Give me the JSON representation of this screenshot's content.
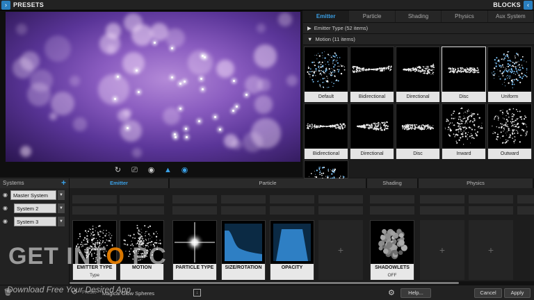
{
  "topbar": {
    "left_title": "PRESETS",
    "right_title": "BLOCKS",
    "left_arrow": "›",
    "right_arrow": "‹"
  },
  "preview_toolbar": [
    {
      "name": "reset-icon",
      "glyph": "↻"
    },
    {
      "name": "camera-icon",
      "glyph": "⎚"
    },
    {
      "name": "audio-icon",
      "glyph": "◉"
    },
    {
      "name": "emitter-icon",
      "glyph": "▲"
    },
    {
      "name": "eye-icon",
      "glyph": "◉"
    }
  ],
  "blocks": {
    "tabs": [
      "Emitter",
      "Particle",
      "Shading",
      "Physics",
      "Aux System"
    ],
    "active_tab": "Emitter",
    "categories": [
      {
        "label": "Emitter Type",
        "count": "(52 items)",
        "expanded": false
      },
      {
        "label": "Motion",
        "count": "(11 items)",
        "expanded": true
      }
    ],
    "items": [
      "Default",
      "Bidirectional",
      "Directional",
      "Disc",
      "Uniform",
      "Bidirectional",
      "Directional",
      "Disc",
      "Inward",
      "Outward",
      ""
    ],
    "selected_index": 3
  },
  "systems": {
    "title": "Systems",
    "add": "+",
    "items": [
      "Master System",
      "System 2",
      "System 3"
    ]
  },
  "modules": {
    "sections": [
      "Emitter",
      "Particle",
      "Shading",
      "Physics"
    ],
    "active_section": "Emitter",
    "emitter": [
      {
        "l1": "EMITTER TYPE",
        "l2": "Type"
      },
      {
        "l1": "MOTION",
        "l2": ""
      }
    ],
    "particle": [
      {
        "l1": "PARTICLE TYPE",
        "l2": ""
      },
      {
        "l1": "SIZE/ROTATION",
        "l2": ""
      },
      {
        "l1": "OPACITY",
        "l2": ""
      }
    ],
    "shading": [
      {
        "l1": "SHADOWLETS",
        "l2": "OFF"
      }
    ]
  },
  "bottombar": {
    "preset_label": "Preset",
    "preset_name": "Magical Glow Spheres",
    "help": "Help...",
    "cancel": "Cancel",
    "apply": "Apply"
  },
  "watermark": {
    "big_pre": "GET INT",
    "big_o": "O",
    "big_post": " PC",
    "small": "Download Free Your Desired App"
  },
  "colors": {
    "accent": "#3aa0e6",
    "preview_purple": "#8a5cc0"
  }
}
